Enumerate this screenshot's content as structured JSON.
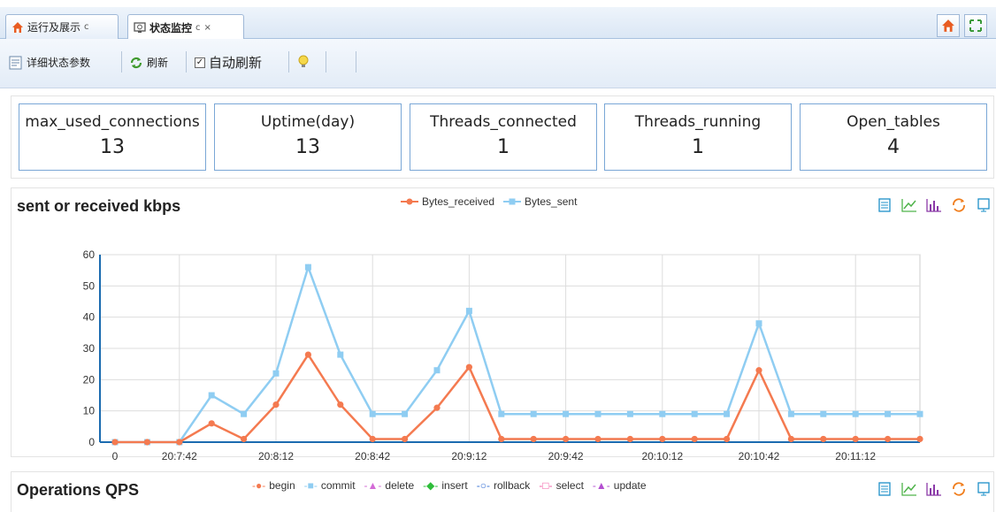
{
  "tabs": [
    {
      "label": "运行及展示",
      "refresh": "c"
    },
    {
      "label": "状态监控",
      "refresh": "c",
      "close": "×"
    }
  ],
  "toolbar": {
    "details_label": "详细状态参数",
    "refresh_label": "刷新",
    "auto_refresh_label": "自动刷新",
    "auto_refresh_checked": true
  },
  "stats": [
    {
      "key": "max_used_connections",
      "value": "13"
    },
    {
      "key": "Uptime(day)",
      "value": "13"
    },
    {
      "key": "Threads_connected",
      "value": "1"
    },
    {
      "key": "Threads_running",
      "value": "1"
    },
    {
      "key": "Open_tables",
      "value": "4"
    }
  ],
  "colors": {
    "received": "#f47a50",
    "sent": "#8fcdf2"
  },
  "chart1": {
    "title": "sent or received kbps",
    "chart_data": {
      "type": "line",
      "x_tick_labels": [
        "0",
        "20:7:42",
        "20:8:12",
        "20:8:42",
        "20:9:12",
        "20:9:42",
        "20:10:12",
        "20:10:42",
        "20:11:12"
      ],
      "y_ticks": [
        0,
        10,
        20,
        30,
        40,
        50,
        60
      ],
      "ylim": [
        0,
        60
      ],
      "grid": true,
      "legend_position": "top-center",
      "series": [
        {
          "name": "Bytes_received",
          "marker": "circle",
          "values": [
            0,
            0,
            0,
            6,
            1,
            12,
            28,
            12,
            1,
            1,
            11,
            24,
            1,
            1,
            1,
            1,
            1,
            1,
            1,
            1,
            23,
            1,
            1,
            1,
            1,
            1
          ]
        },
        {
          "name": "Bytes_sent",
          "marker": "square",
          "values": [
            0,
            0,
            0,
            15,
            9,
            22,
            56,
            28,
            9,
            9,
            23,
            42,
            9,
            9,
            9,
            9,
            9,
            9,
            9,
            9,
            38,
            9,
            9,
            9,
            9,
            9
          ]
        }
      ]
    }
  },
  "chart2": {
    "title": "Operations QPS",
    "legend": [
      {
        "name": "begin",
        "color": "#f47a50",
        "marker": "●"
      },
      {
        "name": "commit",
        "color": "#8fcdf2",
        "marker": "■"
      },
      {
        "name": "delete",
        "color": "#d36bd6",
        "marker": "▲"
      },
      {
        "name": "insert",
        "color": "#2ebd3a",
        "marker": "◆"
      },
      {
        "name": "rollback",
        "color": "#3a73d6",
        "marker": "○"
      },
      {
        "name": "select",
        "color": "#f25ca6",
        "marker": "□"
      },
      {
        "name": "update",
        "color": "#b44fd1",
        "marker": "▲"
      }
    ]
  }
}
